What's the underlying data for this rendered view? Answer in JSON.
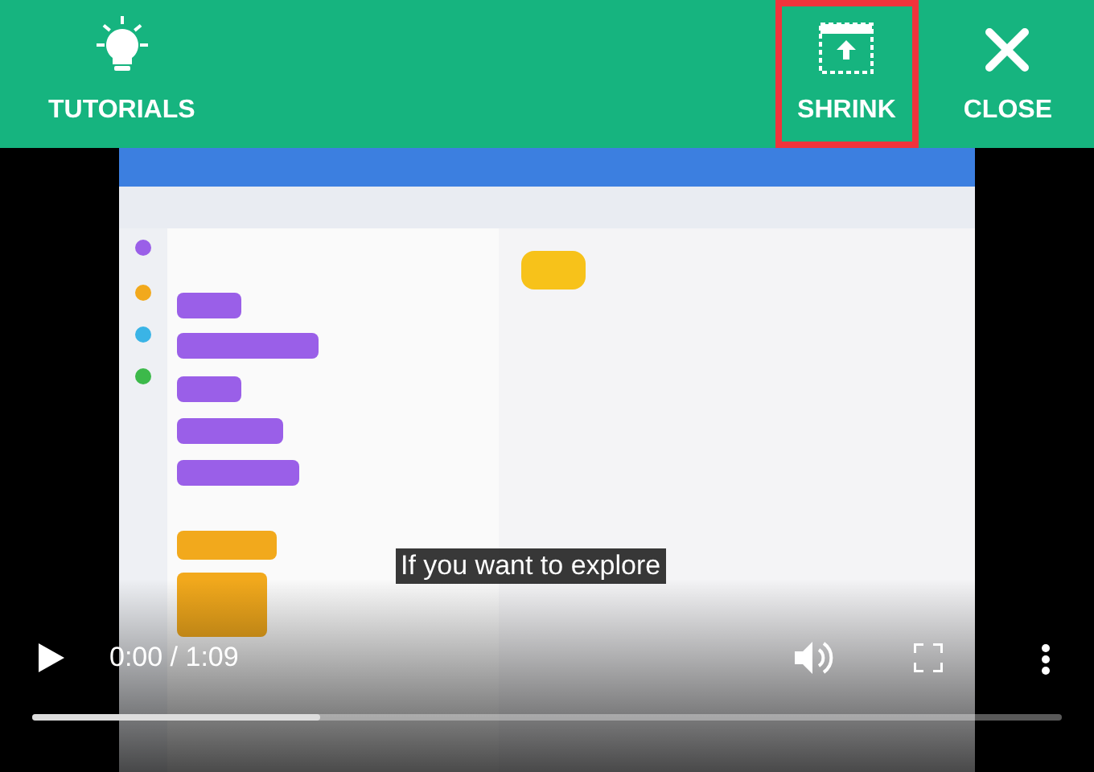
{
  "toolbar": {
    "buttons": [
      {
        "kind": "tutorials",
        "label": "TUTORIALS",
        "highlighted": false
      },
      {
        "kind": "shrink",
        "label": "SHRINK",
        "highlighted": true
      },
      {
        "kind": "close",
        "label": "CLOSE",
        "highlighted": false
      }
    ]
  },
  "video": {
    "caption": "If you want to explore",
    "time": "0:00 / 1:09",
    "buffered": {
      "level": 0.28
    }
  }
}
